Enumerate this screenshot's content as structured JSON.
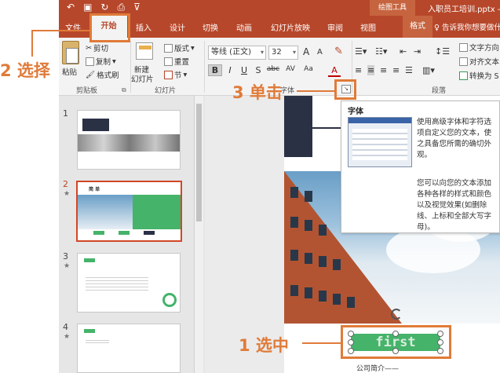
{
  "window": {
    "title": "入职员工培训.pptx - ",
    "context_tool": "绘图工具"
  },
  "quick_access": {
    "icons": [
      "undo-icon",
      "save-icon",
      "redo-icon",
      "print-preview-icon",
      "customize-icon"
    ]
  },
  "tabs": [
    "文件",
    "开始",
    "插入",
    "设计",
    "切换",
    "动画",
    "幻灯片放映",
    "审阅",
    "视图",
    "格式"
  ],
  "active_tab": "开始",
  "tell_me": "告诉我你想要做什么",
  "ribbon": {
    "clipboard": {
      "paste": "粘贴",
      "cut": "剪切",
      "copy": "复制",
      "format_painter": "格式刷",
      "label": "剪贴板"
    },
    "slides": {
      "new_slide": "新建",
      "new_slide2": "幻灯片",
      "layout": "版式",
      "reset": "重置",
      "section": "节",
      "label": "幻灯片"
    },
    "font": {
      "font_name": "等线 (正文)",
      "font_size": "32",
      "grow": "A",
      "shrink": "A",
      "bold": "B",
      "italic": "I",
      "underline": "U",
      "shadow": "S",
      "strike": "abc",
      "spacing": "AV",
      "case": "Aa",
      "color": "A",
      "label": "字体"
    },
    "paragraph": {
      "text_direction": "文字方向",
      "align_text": "对齐文本",
      "convert_smartart": "转换为 S",
      "label": "段落"
    }
  },
  "slides_panel": [
    {
      "number": "1",
      "star": ""
    },
    {
      "number": "2",
      "star": "★"
    },
    {
      "number": "3",
      "star": "★"
    },
    {
      "number": "4",
      "star": "★"
    }
  ],
  "thumb_text": {
    "slide2_heading": "简 单"
  },
  "tooltip": {
    "title": "字体",
    "para1": "使用高级字体和字符选项自定义您的文本，使之具备您所需的确切外观。",
    "para2": "您可以向您的文本添加各种各样的样式和颜色以及视觉效果(如删除线、上标和全部大写字母)。"
  },
  "slide_content": {
    "textbox_text": "first",
    "intro_text": "公司简介——"
  },
  "annotations": {
    "step1": "1 选中",
    "step2": "2 选择",
    "step3": "3 单击"
  },
  "colors": {
    "brand": "#b7472a",
    "annotation": "#e07b39",
    "green": "#45b36a"
  }
}
